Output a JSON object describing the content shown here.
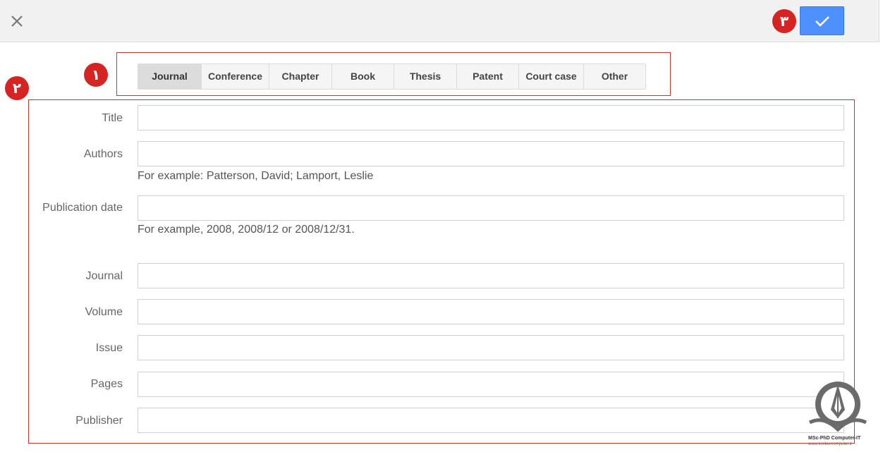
{
  "toolbar": {
    "close_icon": "close-icon",
    "confirm_icon": "checkmark-icon",
    "accent_color": "#4d90fe"
  },
  "markers": {
    "one": "١",
    "two": "٢",
    "three": "٣",
    "color": "#d42424"
  },
  "tabs": [
    {
      "label": "Journal",
      "active": true
    },
    {
      "label": "Conference",
      "active": false
    },
    {
      "label": "Chapter",
      "active": false
    },
    {
      "label": "Book",
      "active": false
    },
    {
      "label": "Thesis",
      "active": false
    },
    {
      "label": "Patent",
      "active": false
    },
    {
      "label": "Court case",
      "active": false
    },
    {
      "label": "Other",
      "active": false
    }
  ],
  "form": {
    "title": {
      "label": "Title",
      "value": ""
    },
    "authors": {
      "label": "Authors",
      "value": "",
      "hint": "For example: Patterson, David; Lamport, Leslie"
    },
    "publication_date": {
      "label": "Publication date",
      "value": "",
      "hint": "For example, 2008, 2008/12 or 2008/12/31."
    },
    "journal": {
      "label": "Journal",
      "value": ""
    },
    "volume": {
      "label": "Volume",
      "value": ""
    },
    "issue": {
      "label": "Issue",
      "value": ""
    },
    "pages": {
      "label": "Pages",
      "value": ""
    },
    "publisher": {
      "label": "Publisher",
      "value": ""
    }
  },
  "watermark": {
    "line1": "MSc-PhD Computer-IT",
    "line2": "www.konkurcomputer.ir"
  }
}
